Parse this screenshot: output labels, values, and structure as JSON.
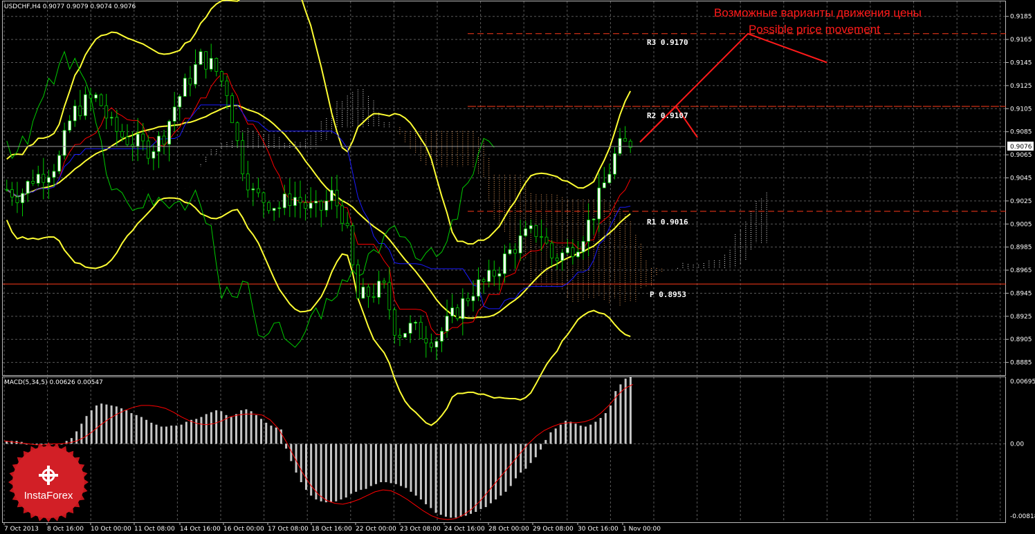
{
  "header": {
    "symbol_label": "USDCHF,H4",
    "ohlc": "0.9077 0.9079 0.9074 0.9076"
  },
  "macd_header": {
    "label": "MACD(5,34,5)",
    "values": "0.00626 0.00547"
  },
  "annotation": {
    "line1": "Возможные варианты движения цены",
    "line2": "Possible price movement"
  },
  "pivot_labels": {
    "r3": "R3  0.9170",
    "r2": "R2  0.9107",
    "r1": "R1  0.9016",
    "p": "P  0.8953"
  },
  "current_price_label": "0.9076",
  "logo": {
    "text": "InstaForex"
  },
  "colors": {
    "background": "#000000",
    "grid": "#5a5a5a",
    "bull_candle": "#ffffff",
    "bear_candle": "#000000",
    "candle_wick": "#00cc00",
    "bollinger": "#ffff33",
    "tenkan": "#ff0000",
    "kijun": "#1a1aff",
    "chikou": "#00cc00",
    "kumo": "#f0f0f0",
    "pivot_line": "#ff3b1a",
    "macd_hist": "#c8c8c8",
    "macd_signal": "#ff0000",
    "annotation": "#ff1a1a"
  },
  "chart_data": [
    {
      "type": "candlestick",
      "title": "USDCHF,H4",
      "y_ticks": [
        "0.9185",
        "0.9165",
        "0.9145",
        "0.9125",
        "0.9105",
        "0.9085",
        "0.9065",
        "0.9045",
        "0.9025",
        "0.9005",
        "0.8985",
        "0.8965",
        "0.8945",
        "0.8925",
        "0.8905",
        "0.8885"
      ],
      "y_tick_values": [
        0.9185,
        0.9165,
        0.9145,
        0.9125,
        0.9105,
        0.9085,
        0.9065,
        0.9045,
        0.9025,
        0.9005,
        0.8985,
        0.8965,
        0.8945,
        0.8925,
        0.8905,
        0.8885
      ],
      "ylim": [
        0.8874,
        0.9198
      ],
      "x_ticks": [
        "7 Oct 2013",
        "8 Oct 16:00",
        "10 Oct 00:00",
        "11 Oct 08:00",
        "14 Oct 16:00",
        "16 Oct 00:00",
        "17 Oct 08:00",
        "18 Oct 16:00",
        "22 Oct 00:00",
        "23 Oct 08:00",
        "24 Oct 16:00",
        "28 Oct 00:00",
        "29 Oct 08:00",
        "30 Oct 16:00",
        "1 Nov 00:00"
      ],
      "close_path": [
        0.9035,
        0.903,
        0.9045,
        0.905,
        0.906,
        0.91,
        0.911,
        0.9115,
        0.909,
        0.908,
        0.9075,
        0.907,
        0.908,
        0.911,
        0.913,
        0.915,
        0.914,
        0.912,
        0.906,
        0.903,
        0.9025,
        0.902,
        0.903,
        0.902,
        0.9015,
        0.903,
        0.901,
        0.894,
        0.8945,
        0.895,
        0.891,
        0.8915,
        0.891,
        0.8905,
        0.892,
        0.8935,
        0.895,
        0.8955,
        0.897,
        0.8985,
        0.8995,
        0.9,
        0.8975,
        0.898,
        0.899,
        0.901,
        0.904,
        0.907,
        0.9076
      ],
      "current_price": 0.9076,
      "pivot_levels": [
        {
          "name": "R3",
          "value": 0.917
        },
        {
          "name": "R2",
          "value": 0.9107
        },
        {
          "name": "R1",
          "value": 0.9016
        },
        {
          "name": "P",
          "value": 0.8953
        }
      ],
      "projection_paths": [
        [
          [
            0.0,
            0.9076
          ],
          [
            0.3,
            0.917
          ],
          [
            0.52,
            0.9145
          ]
        ],
        [
          [
            0.0,
            0.9076
          ],
          [
            0.1,
            0.9107
          ],
          [
            0.16,
            0.908
          ]
        ]
      ]
    },
    {
      "type": "bar",
      "title": "MACD(5,34,5)",
      "y_ticks": [
        "0.00695",
        "0.00",
        "-0.00818"
      ],
      "y_tick_values": [
        0.00695,
        0.0,
        -0.00818
      ],
      "ylim": [
        -0.00818,
        0.00695
      ],
      "histogram": [
        0.0003,
        0.0003,
        0.0003,
        0.0002,
        0.0,
        0.0,
        0.0,
        0.0,
        0.0,
        0.0,
        0.0,
        0.0,
        0.0003,
        0.0006,
        0.0013,
        0.0021,
        0.0029,
        0.0035,
        0.004,
        0.0042,
        0.0041,
        0.004,
        0.0039,
        0.0037,
        0.0035,
        0.0032,
        0.003,
        0.0028,
        0.0025,
        0.0022,
        0.002,
        0.0018,
        0.0018,
        0.0019,
        0.0019,
        0.002,
        0.0023,
        0.0025,
        0.0026,
        0.0028,
        0.0031,
        0.0033,
        0.0035,
        0.0034,
        0.003,
        0.0028,
        0.0031,
        0.0035,
        0.0036,
        0.0034,
        0.003,
        0.0026,
        0.0022,
        0.0019,
        0.0017,
        0.0015,
        -0.0005,
        -0.0018,
        -0.003,
        -0.004,
        -0.0048,
        -0.0054,
        -0.0058,
        -0.006,
        -0.0061,
        -0.0061,
        -0.006,
        -0.0058,
        -0.0056,
        -0.0052,
        -0.005,
        -0.0048,
        -0.0047,
        -0.0044,
        -0.0042,
        -0.004,
        -0.004,
        -0.0041,
        -0.0042,
        -0.0044,
        -0.0046,
        -0.005,
        -0.0054,
        -0.0058,
        -0.0063,
        -0.0067,
        -0.0072,
        -0.0074,
        -0.0076,
        -0.0077,
        -0.0077,
        -0.0076,
        -0.0075,
        -0.0073,
        -0.0071,
        -0.0068,
        -0.0066,
        -0.0062,
        -0.0058,
        -0.0054,
        -0.005,
        -0.0044,
        -0.0036,
        -0.003,
        -0.0026,
        -0.002,
        -0.0014,
        -0.0006,
        0.0004,
        0.0012,
        0.0016,
        0.002,
        0.0024,
        0.0023,
        0.0021,
        0.0019,
        0.0018,
        0.002,
        0.0023,
        0.0027,
        0.0032,
        0.004,
        0.0055,
        0.0062,
        0.0068,
        0.007
      ],
      "signal": [
        0.0003,
        0.0002,
        0.0001,
        0.0,
        -0.0001,
        -0.0001,
        0.0,
        0.0,
        0.0001,
        0.0003,
        0.0007,
        0.0013,
        0.002,
        0.0026,
        0.0031,
        0.0035,
        0.0038,
        0.004,
        0.004,
        0.0039,
        0.0037,
        0.0033,
        0.0028,
        0.0024,
        0.0021,
        0.002,
        0.0021,
        0.0024,
        0.0028,
        0.003,
        0.0031,
        0.0031,
        0.003,
        0.0025,
        0.0016,
        0.0002,
        -0.0014,
        -0.003,
        -0.0043,
        -0.0053,
        -0.0059,
        -0.0062,
        -0.0063,
        -0.0061,
        -0.0058,
        -0.0054,
        -0.005,
        -0.0048,
        -0.0049,
        -0.0053,
        -0.0058,
        -0.0064,
        -0.007,
        -0.0075,
        -0.0078,
        -0.0079,
        -0.0078,
        -0.0074,
        -0.0068,
        -0.006,
        -0.005,
        -0.004,
        -0.003,
        -0.002,
        -0.001,
        0.0,
        0.0008,
        0.0014,
        0.0018,
        0.0021,
        0.0022,
        0.0022,
        0.0023,
        0.0026,
        0.0032,
        0.004,
        0.005,
        0.0058,
        0.0062
      ]
    }
  ]
}
